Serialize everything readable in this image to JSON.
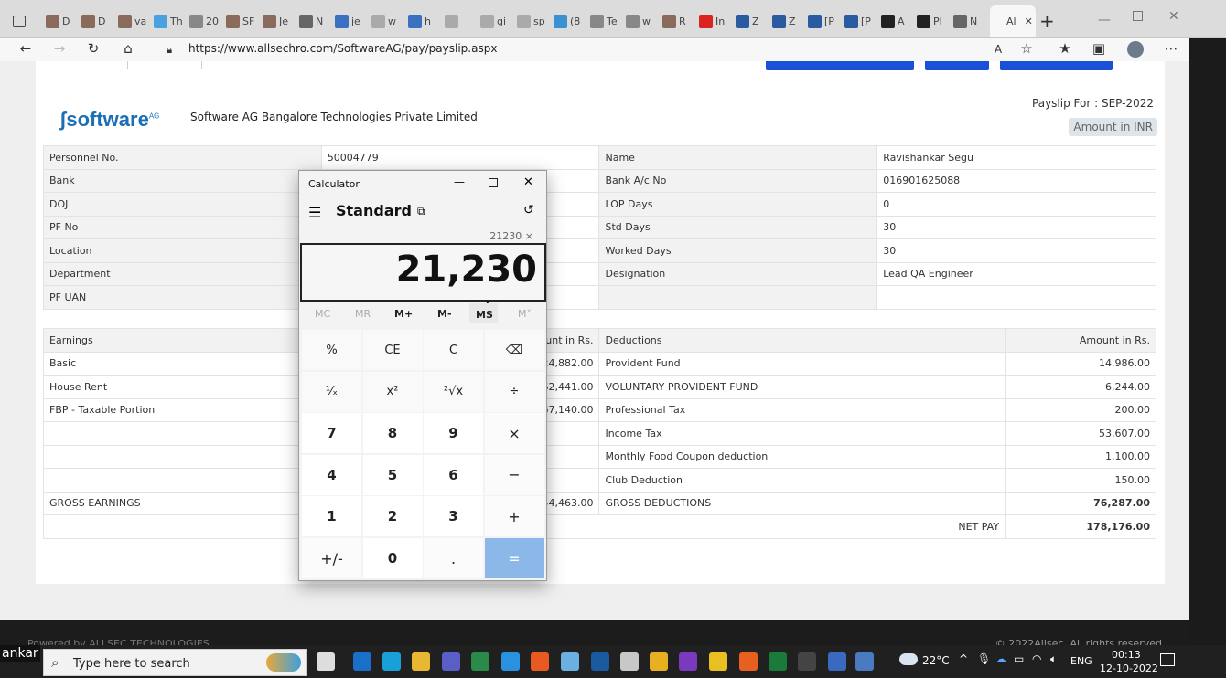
{
  "browser": {
    "tabs": [
      {
        "label": "D",
        "icon": "avatar-icon"
      },
      {
        "label": "D",
        "icon": "avatar-icon"
      },
      {
        "label": "va",
        "icon": "avatar-icon"
      },
      {
        "label": "Th",
        "icon": "loading-icon"
      },
      {
        "label": "20",
        "icon": "page-icon"
      },
      {
        "label": "SF",
        "icon": "avatar-icon"
      },
      {
        "label": "Je",
        "icon": "avatar-icon"
      },
      {
        "label": "N",
        "icon": "mail-icon"
      },
      {
        "label": "je",
        "icon": "search-icon"
      },
      {
        "label": "w",
        "icon": "link-icon"
      },
      {
        "label": "h",
        "icon": "search-icon"
      },
      {
        "label": "",
        "icon": "link-icon"
      },
      {
        "label": "gi",
        "icon": "link-icon"
      },
      {
        "label": "sp",
        "icon": "link-icon"
      },
      {
        "label": "(8",
        "icon": "snow-icon"
      },
      {
        "label": "Te",
        "icon": "page-icon"
      },
      {
        "label": "w",
        "icon": "page-icon"
      },
      {
        "label": "R",
        "icon": "avatar-icon"
      },
      {
        "label": "In",
        "icon": "play-icon"
      },
      {
        "label": "Z",
        "icon": "monitor-icon"
      },
      {
        "label": "Z",
        "icon": "monitor-icon"
      },
      {
        "label": "[P",
        "icon": "monitor-icon"
      },
      {
        "label": "[P",
        "icon": "monitor-icon"
      },
      {
        "label": "A",
        "icon": "github-icon"
      },
      {
        "label": "Pl",
        "icon": "github-icon"
      },
      {
        "label": "N",
        "icon": "mail-icon"
      },
      {
        "label": "Al",
        "icon": "none"
      }
    ],
    "url": "https://www.allsechro.com/SoftwareAG/pay/payslip.aspx",
    "close_symbol": "✕",
    "new_tab_symbol": "+"
  },
  "payslip": {
    "logo_text": "software",
    "logo_suffix": "AG",
    "company": "Software AG Bangalore Technologies Private Limited",
    "payslip_for": "Payslip For : SEP-2022",
    "amount_in": "Amount in INR",
    "info_rows": [
      {
        "l1": "Personnel No.",
        "v1": "50004779",
        "l2": "Name",
        "v2": "Ravishankar Segu"
      },
      {
        "l1": "Bank",
        "v1": "",
        "l2": "Bank A/c No",
        "v2": "016901625088"
      },
      {
        "l1": "DOJ",
        "v1": "",
        "l2": "LOP Days",
        "v2": "0"
      },
      {
        "l1": "PF No",
        "v1": "",
        "l2": "Std Days",
        "v2": "30"
      },
      {
        "l1": "Location",
        "v1": "",
        "l2": "Worked Days",
        "v2": "30"
      },
      {
        "l1": "Department",
        "v1": "",
        "l2": "Designation",
        "v2": "Lead QA Engineer"
      },
      {
        "l1": "PF UAN",
        "v1": "",
        "l2": "",
        "v2": ""
      }
    ],
    "earn_header": {
      "c1": "Earnings",
      "c2": "ount in Rs.",
      "c3": "Deductions",
      "c4": "Amount in Rs."
    },
    "earn_rows": [
      {
        "e": "Basic",
        "ea": "124,882.00",
        "d": "Provident Fund",
        "da": "14,986.00"
      },
      {
        "e": "House Rent",
        "ea": "62,441.00",
        "d": "VOLUNTARY PROVIDENT FUND",
        "da": "6,244.00"
      },
      {
        "e": "FBP - Taxable Portion",
        "ea": "67,140.00",
        "d": "Professional Tax",
        "da": "200.00"
      },
      {
        "e": "",
        "ea": "",
        "d": "Income Tax",
        "da": "53,607.00"
      },
      {
        "e": "",
        "ea": "",
        "d": "Monthly Food Coupon deduction",
        "da": "1,100.00"
      },
      {
        "e": "",
        "ea": "",
        "d": "Club Deduction",
        "da": "150.00"
      }
    ],
    "gross": {
      "e": "GROSS EARNINGS",
      "ea": "254,463.00",
      "d": "GROSS DEDUCTIONS",
      "da": "76,287.00"
    },
    "net": {
      "label": "NET PAY",
      "value": "178,176.00"
    },
    "footer_left": "Powered by  ALLSEC TECHNOLOGIES",
    "footer_right": "© 2022Allsec. All rights reserved"
  },
  "calculator": {
    "title": "Calculator",
    "mode": "Standard",
    "expression": "21230 ×",
    "display": "21,230",
    "memory": [
      "MC",
      "MR",
      "M+",
      "M-",
      "MS",
      "M˅"
    ],
    "keys": [
      [
        "%",
        "CE",
        "C",
        "⌫"
      ],
      [
        "¹⁄ₓ",
        "x²",
        "²√x",
        "÷"
      ],
      [
        "7",
        "8",
        "9",
        "×"
      ],
      [
        "4",
        "5",
        "6",
        "−"
      ],
      [
        "1",
        "2",
        "3",
        "+"
      ],
      [
        "+/-",
        "0",
        ".",
        "="
      ]
    ]
  },
  "taskbar": {
    "user_fragment": "ankar",
    "search_placeholder": "Type here to search",
    "weather": "22°C",
    "lang": "ENG",
    "time": "00:13",
    "date": "12-10-2022"
  }
}
